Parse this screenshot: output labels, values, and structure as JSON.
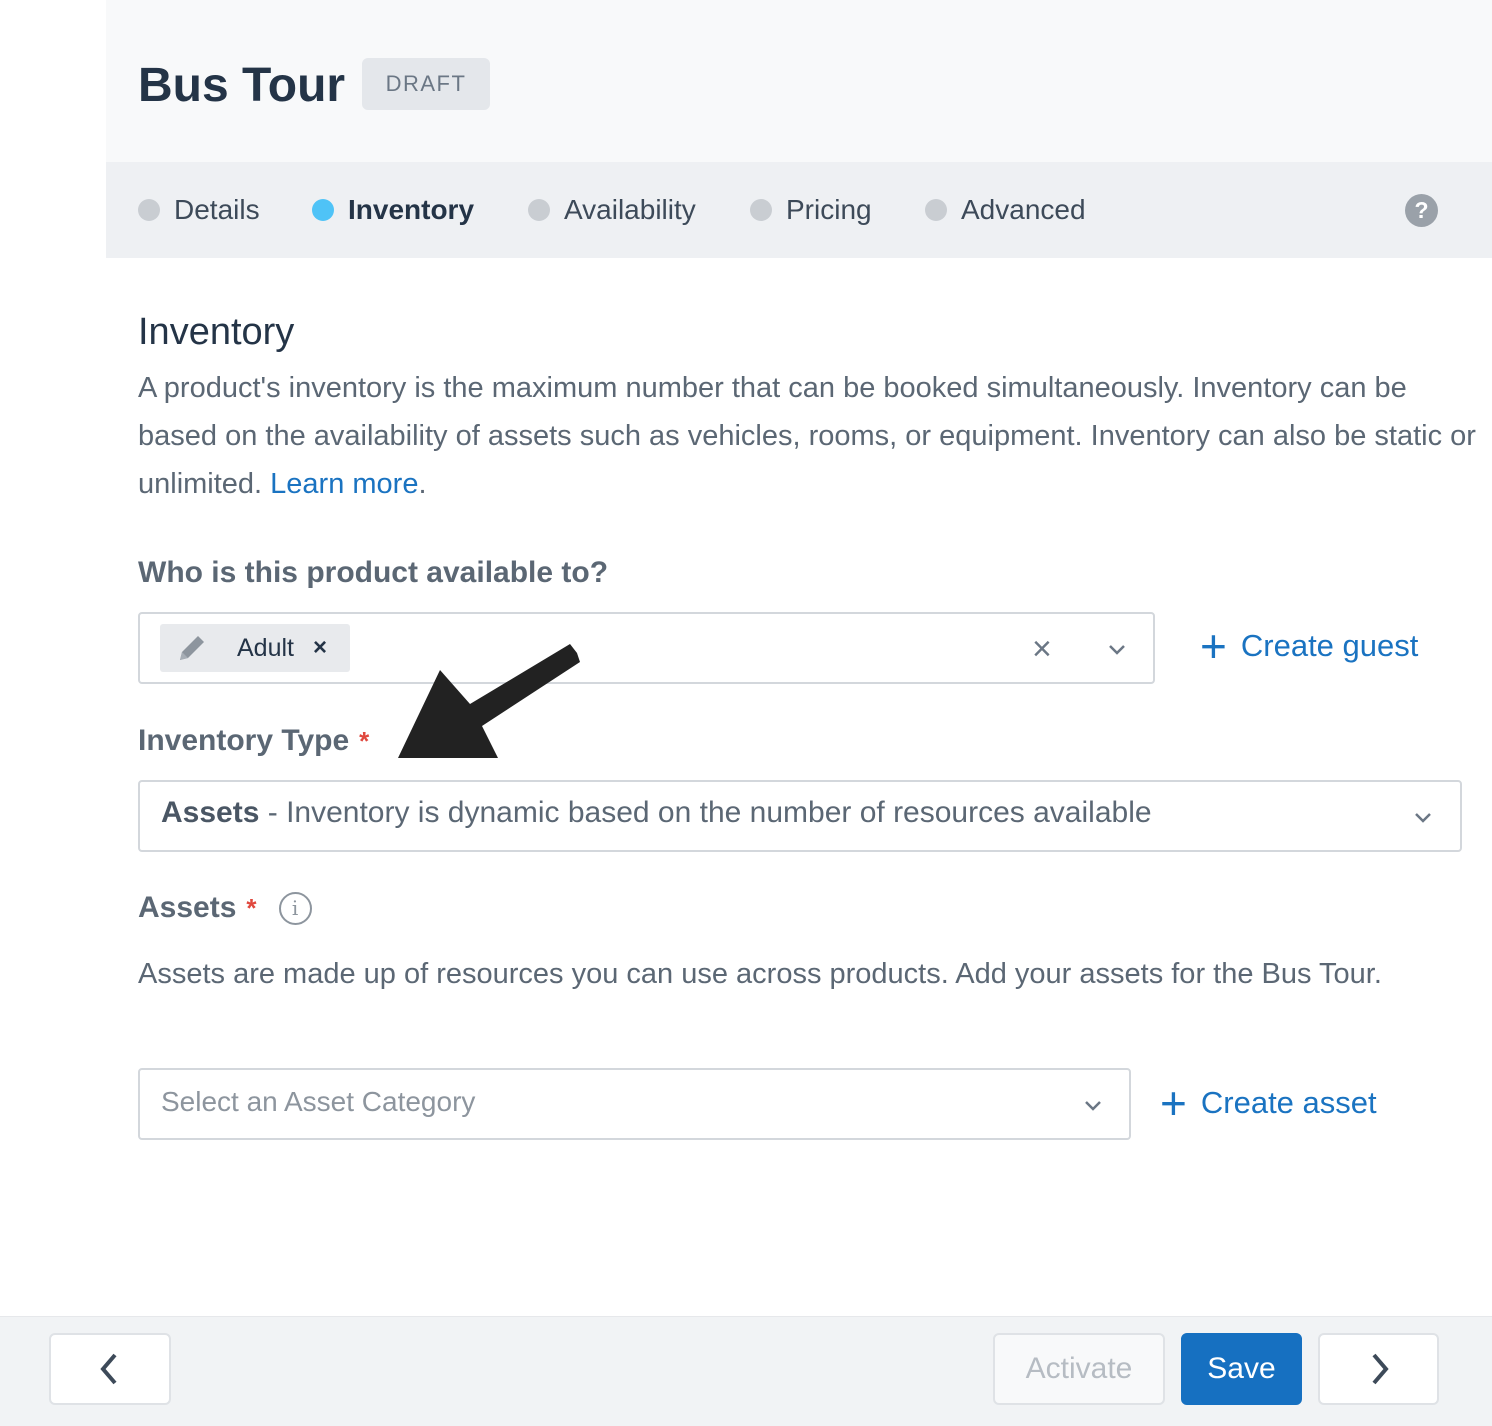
{
  "header": {
    "title": "Bus Tour",
    "badge": "DRAFT"
  },
  "tabs": [
    {
      "label": "Details",
      "active": false
    },
    {
      "label": "Inventory",
      "active": true
    },
    {
      "label": "Availability",
      "active": false
    },
    {
      "label": "Pricing",
      "active": false
    },
    {
      "label": "Advanced",
      "active": false
    }
  ],
  "help_icon": "?",
  "section": {
    "title": "Inventory",
    "description": "A product's inventory is the maximum number that can be booked simultaneously. Inventory can be based on the availability of assets such as vehicles, rooms, or equipment. Inventory can also be static or unlimited. ",
    "learn_more": "Learn more",
    "period": "."
  },
  "availability": {
    "label": "Who is this product available to?",
    "chip_label": "Adult",
    "chip_remove": "×",
    "clear": "×",
    "create_label": "Create guest"
  },
  "inventory_type": {
    "label": "Inventory Type",
    "required_mark": "*",
    "selected_name": "Assets",
    "selected_description": " - Inventory is dynamic based on the number of resources available"
  },
  "assets": {
    "label": "Assets",
    "required_mark": "*",
    "info_icon": "i",
    "description": "Assets are made up of resources you can use across products. Add your assets for the Bus Tour.",
    "placeholder": "Select an Asset Category",
    "create_label": "Create asset"
  },
  "footer": {
    "activate_label": "Activate",
    "save_label": "Save"
  },
  "colors": {
    "accent": "#1670c1",
    "active_tab_dot": "#4fc3f7",
    "required": "#e0483e"
  }
}
